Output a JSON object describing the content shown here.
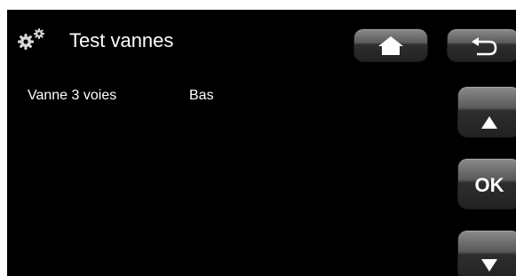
{
  "header": {
    "title": "Test vannes",
    "settings_icon": "gears-icon",
    "home_icon": "home-icon",
    "back_icon": "back-arrow-icon"
  },
  "rows": [
    {
      "label": "Vanne 3 voies",
      "value": "Bas"
    }
  ],
  "nav": {
    "up_icon": "up-arrow-icon",
    "ok_label": "OK",
    "down_icon": "down-arrow-icon"
  },
  "colors": {
    "background": "#000000",
    "text": "#ffffff",
    "button_top": "#8a8a8a",
    "button_bottom": "#222222"
  }
}
